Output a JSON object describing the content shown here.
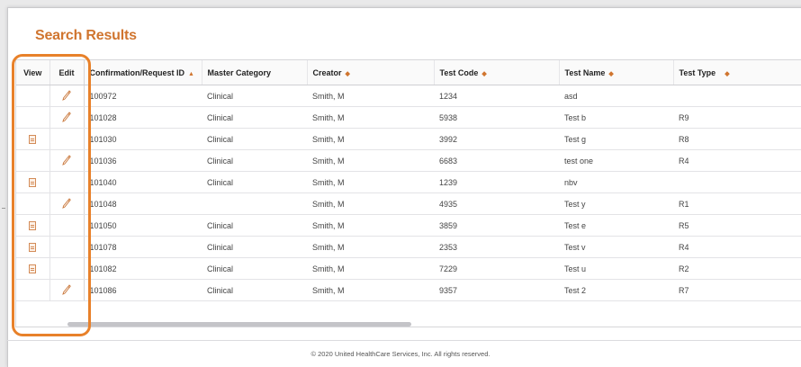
{
  "page": {
    "title": "Search Results",
    "footer": "© 2020 United HealthCare Services, Inc. All rights reserved."
  },
  "colors": {
    "accent": "#d0752f",
    "highlight_border": "#e8812a"
  },
  "table": {
    "columns": {
      "view": "View",
      "edit": "Edit",
      "confirmation_id": "Confirmation/Request ID",
      "master_category": "Master Category",
      "creator": "Creator",
      "test_code": "Test Code",
      "test_name": "Test Name",
      "test_type": "Test Type"
    },
    "sort_icons": {
      "confirmation_id": "▲",
      "creator": "◆",
      "test_code": "◆",
      "test_name": "◆",
      "test_type": "◆"
    },
    "rows": [
      {
        "view": false,
        "edit": true,
        "confirmation_id": "100972",
        "master_category": "Clinical",
        "creator": "Smith, M",
        "test_code": "1234",
        "test_name": "asd",
        "test_type": ""
      },
      {
        "view": false,
        "edit": true,
        "confirmation_id": "101028",
        "master_category": "Clinical",
        "creator": "Smith, M",
        "test_code": "5938",
        "test_name": "Test b",
        "test_type": "R9"
      },
      {
        "view": true,
        "edit": false,
        "confirmation_id": "101030",
        "master_category": "Clinical",
        "creator": "Smith, M",
        "test_code": "3992",
        "test_name": "Test g",
        "test_type": "R8"
      },
      {
        "view": false,
        "edit": true,
        "confirmation_id": "101036",
        "master_category": "Clinical",
        "creator": "Smith, M",
        "test_code": "6683",
        "test_name": "test one",
        "test_type": "R4"
      },
      {
        "view": true,
        "edit": false,
        "confirmation_id": "101040",
        "master_category": "Clinical",
        "creator": "Smith, M",
        "test_code": "1239",
        "test_name": "nbv",
        "test_type": ""
      },
      {
        "view": false,
        "edit": true,
        "confirmation_id": "101048",
        "master_category": "",
        "creator": "Smith, M",
        "test_code": "4935",
        "test_name": "Test y",
        "test_type": "R1"
      },
      {
        "view": true,
        "edit": false,
        "confirmation_id": "101050",
        "master_category": "Clinical",
        "creator": "Smith, M",
        "test_code": "3859",
        "test_name": "Test e",
        "test_type": "R5"
      },
      {
        "view": true,
        "edit": false,
        "confirmation_id": "101078",
        "master_category": "Clinical",
        "creator": "Smith, M",
        "test_code": "2353",
        "test_name": "Test v",
        "test_type": "R4"
      },
      {
        "view": true,
        "edit": false,
        "confirmation_id": "101082",
        "master_category": "Clinical",
        "creator": "Smith, M",
        "test_code": "7229",
        "test_name": "Test u",
        "test_type": "R2"
      },
      {
        "view": false,
        "edit": true,
        "confirmation_id": "101086",
        "master_category": "Clinical",
        "creator": "Smith, M",
        "test_code": "9357",
        "test_name": "Test 2",
        "test_type": "R7"
      }
    ]
  }
}
